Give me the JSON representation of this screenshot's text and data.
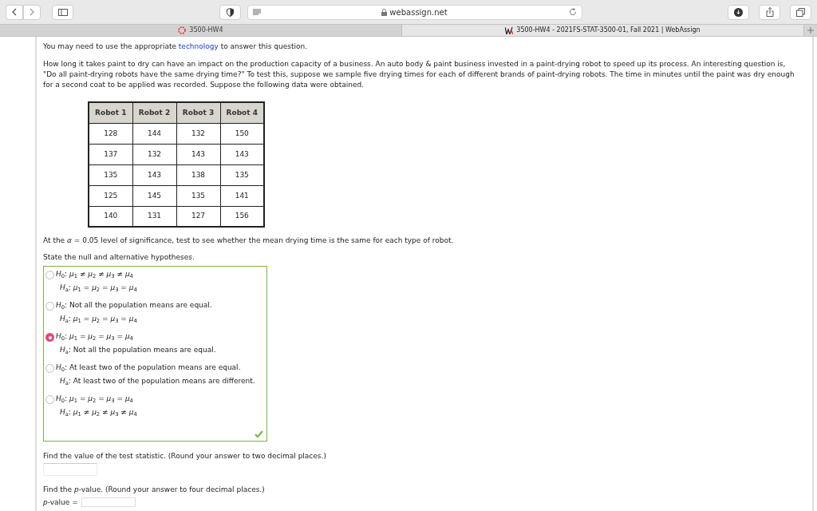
{
  "browser": {
    "address": "webassign.net",
    "tabs": [
      {
        "label": "3500-HW4",
        "selected": false
      },
      {
        "label": "3500-HW4 - 2021FS-STAT-3500-01, Fall 2021 | WebAssign",
        "selected": true
      }
    ]
  },
  "intro": {
    "before": "You may need to use the appropriate",
    "link": "technology",
    "after": "to answer this question."
  },
  "problem": "How long it takes paint to dry can have an impact on the production capacity of a business. An auto body & paint business invested in a paint-drying robot to speed up its process. An interesting question is, \"Do all paint-drying robots have the same drying time?\" To test this, suppose we sample five drying times for each of different brands of paint-drying robots. The time in minutes until the paint was dry enough for a second coat to be applied was recorded. Suppose the following data were obtained.",
  "table": {
    "columns": [
      "Robot 1",
      "Robot 2",
      "Robot 3",
      "Robot 4"
    ],
    "rows": [
      [
        "128",
        "144",
        "132",
        "150"
      ],
      [
        "137",
        "132",
        "143",
        "143"
      ],
      [
        "135",
        "143",
        "138",
        "135"
      ],
      [
        "125",
        "145",
        "135",
        "141"
      ],
      [
        "140",
        "131",
        "127",
        "156"
      ]
    ]
  },
  "significance": "At the *α* = 0.05 level of significance, test to see whether the mean drying time is the same for each type of robot.",
  "hypotheses_prompt": "State the null and alternative hypotheses.",
  "options": [
    {
      "h0": "*H*$_{0}$: *μ*$_{1}$ ≠ *μ*$_{2}$ ≠ *μ*$_{3}$ ≠ *μ*$_{4}$",
      "ha": "*H*$_{a}$: *μ*$_{1}$ = *μ*$_{2}$ = *μ*$_{3}$ = *μ*$_{4}$",
      "selected": false
    },
    {
      "h0": "*H*$_{0}$: Not all the population means are equal.",
      "ha": "*H*$_{a}$: *μ*$_{1}$ = *μ*$_{2}$ = *μ*$_{3}$ = *μ*$_{4}$",
      "selected": false
    },
    {
      "h0": "*H*$_{0}$: *μ*$_{1}$ = *μ*$_{2}$ = *μ*$_{3}$ = *μ*$_{4}$",
      "ha": "*H*$_{a}$: Not all the population means are equal.",
      "selected": true
    },
    {
      "h0": "*H*$_{0}$: At least two of the population means are equal.",
      "ha": "*H*$_{a}$: At least two of the population means are different.",
      "selected": false
    },
    {
      "h0": "*H*$_{0}$: *μ*$_{1}$ = *μ*$_{2}$ = *μ*$_{3}$ = *μ*$_{4}$",
      "ha": "*H*$_{a}$: *μ*$_{1}$ ≠ *μ*$_{2}$ ≠ *μ*$_{3}$ ≠ *μ*$_{4}$",
      "selected": false
    }
  ],
  "answer_correct": true,
  "statistic_prompt": "Find the value of the test statistic. (Round your answer to two decimal places.)",
  "pvalue_prompt": "Find the *p*-value. (Round your answer to four decimal places.)",
  "pvalue_label": "*p*-value ="
}
